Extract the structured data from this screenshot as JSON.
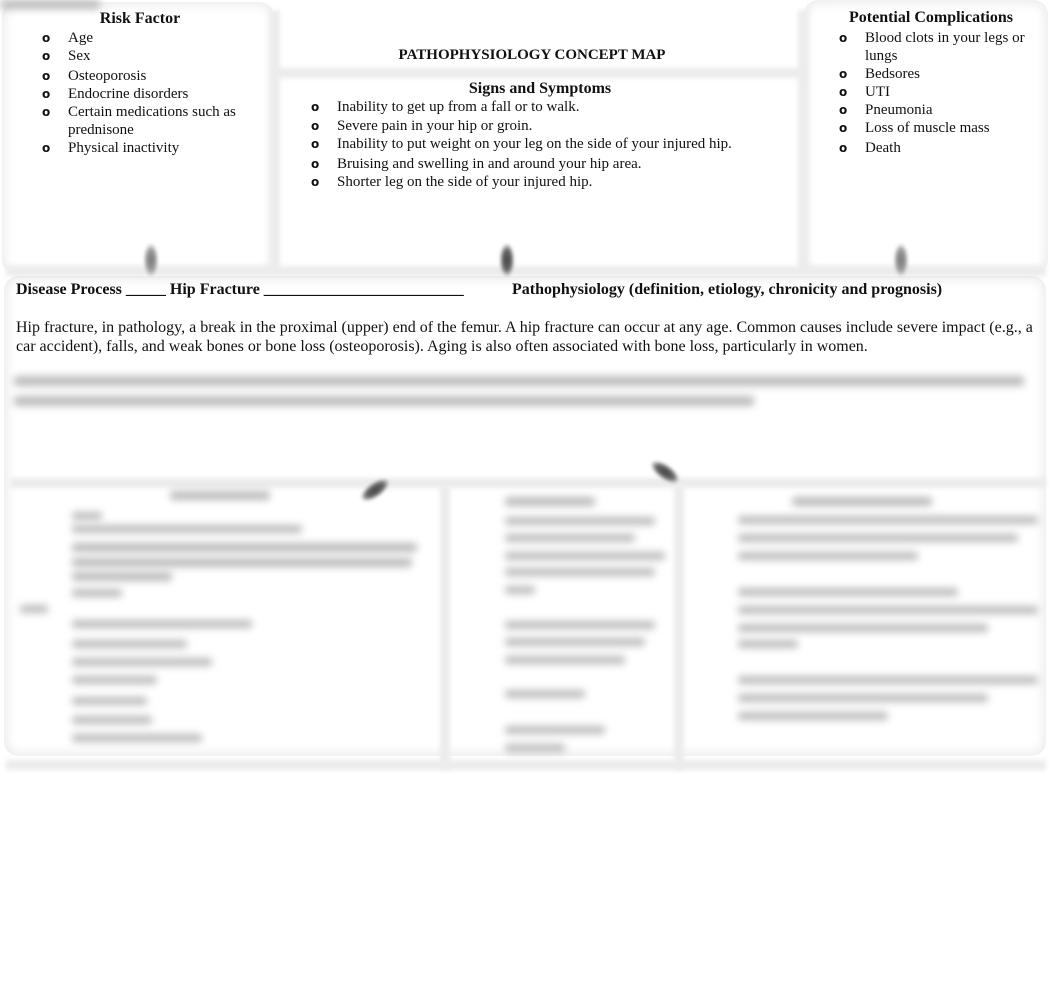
{
  "document": {
    "title": "PATHOPHYSIOLOGY CONCEPT MAP"
  },
  "risk_factor": {
    "heading": "Risk Factor",
    "bullet": "o",
    "items": [
      "Age",
      "Sex",
      "Osteoporosis",
      "Endocrine disorders",
      "Certain medications such as prednisone",
      "Physical inactivity"
    ]
  },
  "signs_symptoms": {
    "heading": "Signs and Symptoms",
    "bullet": "o",
    "items": [
      "Inability to get up from a fall or to walk.",
      "Severe pain in your hip or groin.",
      "Inability to put weight on your leg on the side of your injured hip.",
      "Bruising and swelling in and around your hip area.",
      "Shorter leg on the side of your injured hip."
    ]
  },
  "complications": {
    "heading": "Potential Complications",
    "bullet": "o",
    "items": [
      "Blood clots in your legs or lungs",
      "Bedsores",
      "UTI",
      "Pneumonia",
      "Loss of muscle mass",
      "Death"
    ]
  },
  "disease_process": {
    "label": "Disease Process _____ Hip Fracture _________________________",
    "pathophysiology_label": "Pathophysiology (definition, etiology, chronicity and prognosis)",
    "paragraph": "Hip fracture, in pathology, a break in the proximal (upper) end of the femur. A hip fracture can occur at any age. Common causes include severe impact (e.g., a car accident), falls, and weak bones or bone loss (osteoporosis). Aging is also often associated with bone loss, particularly in women."
  }
}
